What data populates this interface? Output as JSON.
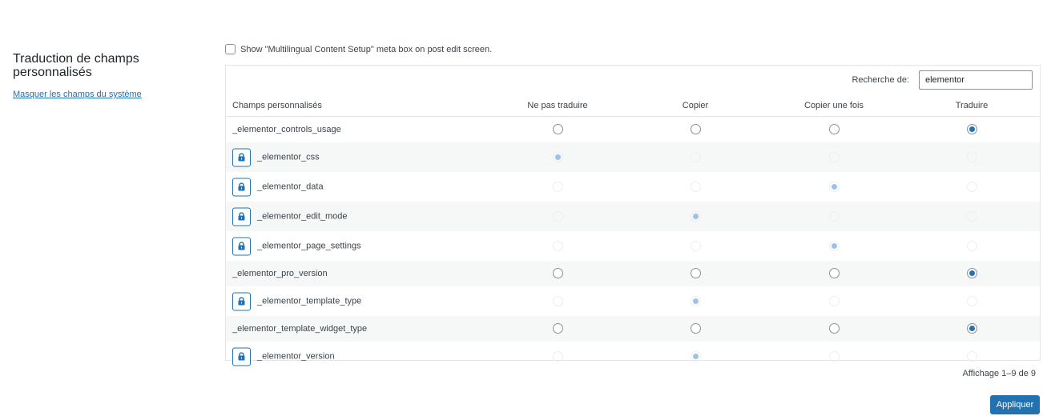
{
  "sidebar": {
    "title": "Traduction de champs personnalisés",
    "link": "Masquer les champs du système"
  },
  "meta_box": {
    "label": "Show \"Multilingual Content Setup\" meta box on post edit screen.",
    "checked": false
  },
  "search": {
    "label": "Recherche de:",
    "value": "elementor"
  },
  "columns": [
    "Champs personnalisés",
    "Ne pas traduire",
    "Copier",
    "Copier une fois",
    "Traduire"
  ],
  "rows": [
    {
      "name": "_elementor_controls_usage",
      "locked": false,
      "selected": 3
    },
    {
      "name": "_elementor_css",
      "locked": true,
      "selected": 0
    },
    {
      "name": "_elementor_data",
      "locked": true,
      "selected": 2
    },
    {
      "name": "_elementor_edit_mode",
      "locked": true,
      "selected": 1
    },
    {
      "name": "_elementor_page_settings",
      "locked": true,
      "selected": 2
    },
    {
      "name": "_elementor_pro_version",
      "locked": false,
      "selected": 3
    },
    {
      "name": "_elementor_template_type",
      "locked": true,
      "selected": 1
    },
    {
      "name": "_elementor_template_widget_type",
      "locked": false,
      "selected": 3
    },
    {
      "name": "_elementor_version",
      "locked": true,
      "selected": 1
    }
  ],
  "pagination": "Affichage 1–9 de 9",
  "apply_label": "Appliquer",
  "colors": {
    "accent": "#2271b1",
    "disabled_dot": "#9ec2e6",
    "stripe": "#f6f7f7"
  }
}
